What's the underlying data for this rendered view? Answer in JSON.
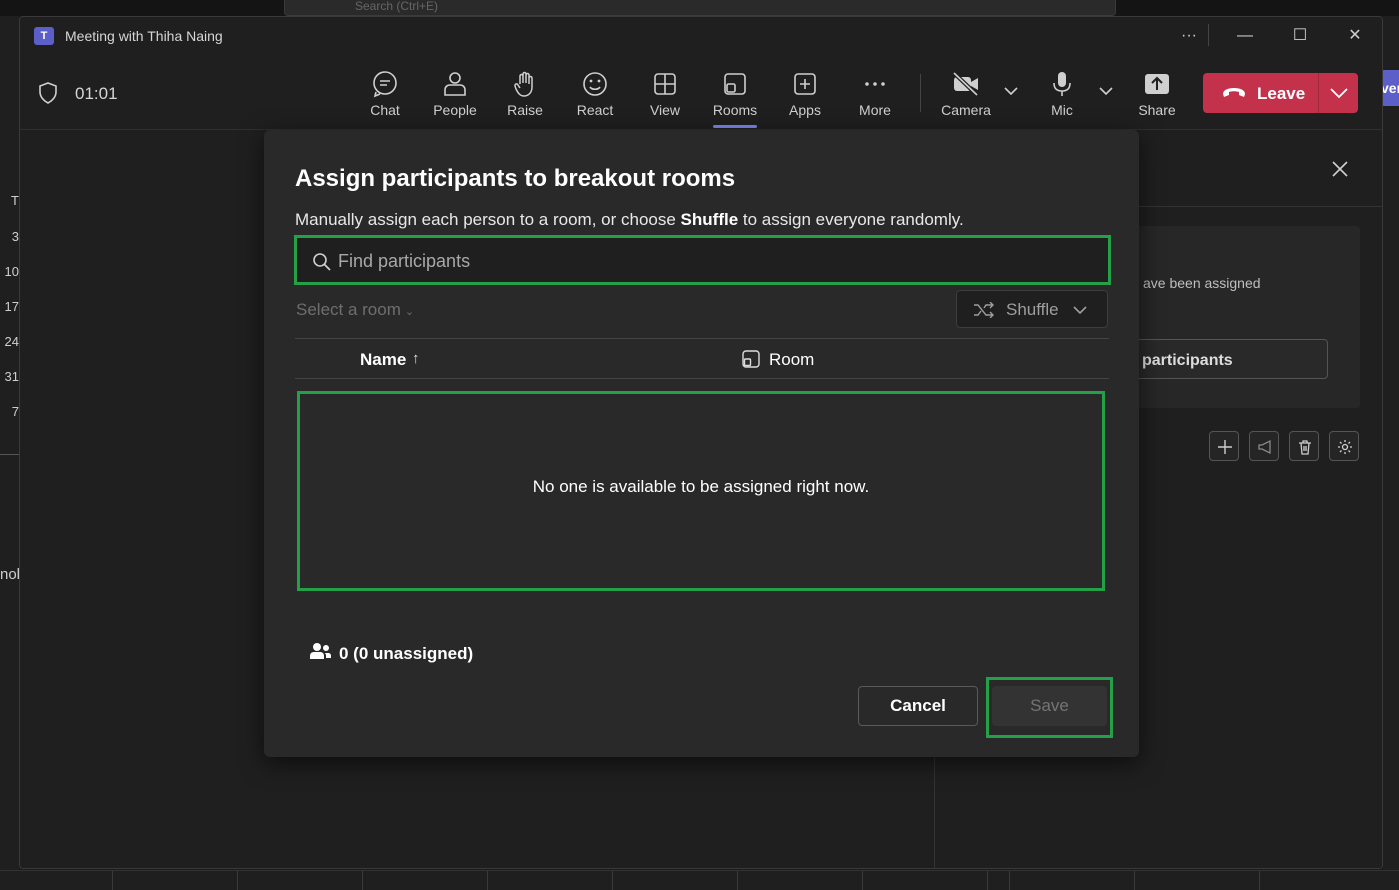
{
  "background": {
    "search_placeholder": "Search (Ctrl+E)",
    "day_letter": "T",
    "day_numbers": [
      "3",
      "10",
      "17",
      "24",
      "31",
      "7"
    ],
    "left_fragment": "nol",
    "right_fragment": "ven"
  },
  "window": {
    "title": "Meeting with Thiha Naing",
    "controls": {
      "more": "···",
      "minimize": "—",
      "maximize": "☐",
      "close": "✕"
    }
  },
  "toolbar": {
    "timer": "01:01",
    "buttons": [
      {
        "label": "Chat",
        "icon": "chat-icon"
      },
      {
        "label": "People",
        "icon": "people-icon"
      },
      {
        "label": "Raise",
        "icon": "hand-icon"
      },
      {
        "label": "React",
        "icon": "smiley-icon"
      },
      {
        "label": "View",
        "icon": "grid-icon"
      },
      {
        "label": "Rooms",
        "icon": "rooms-icon",
        "active": true
      },
      {
        "label": "Apps",
        "icon": "plus-square-icon"
      },
      {
        "label": "More",
        "icon": "ellipsis-icon"
      },
      {
        "label": "Camera",
        "icon": "camera-off-icon"
      },
      {
        "label": "Mic",
        "icon": "mic-icon"
      },
      {
        "label": "Share",
        "icon": "share-icon"
      }
    ],
    "leave_label": "Leave",
    "leave_color": "#c4314b"
  },
  "side_panel": {
    "partial_text": "ave been assigned",
    "partial_button": "participants"
  },
  "modal": {
    "title": "Assign participants to breakout rooms",
    "description_pre": "Manually assign each person to a room, or choose ",
    "description_bold": "Shuffle",
    "description_post": " to assign everyone randomly.",
    "search_placeholder": "Find participants",
    "select_room": "Select a room",
    "shuffle_label": "Shuffle",
    "columns": {
      "name": "Name",
      "name_sort": "↑",
      "room": "Room"
    },
    "empty_message": "No one is available to be assigned right now.",
    "count": "0 (0 unassigned)",
    "cancel_label": "Cancel",
    "save_label": "Save",
    "highlight_color": "#24a148"
  }
}
